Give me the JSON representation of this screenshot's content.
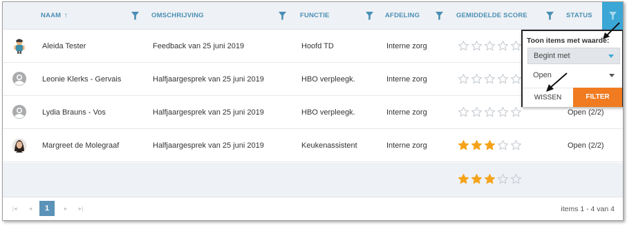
{
  "columns": {
    "naam": "Naam",
    "sort_indicator": "↑",
    "omschrijving": "Omschrijving",
    "functie": "Functie",
    "afdeling": "Afdeling",
    "gemiddelde_score": "Gemiddelde score",
    "status": "Status"
  },
  "rows": [
    {
      "naam": "Aleida Tester",
      "omschrijving": "Feedback van 25 juni 2019",
      "functie": "Hoofd TD",
      "afdeling": "Interne zorg",
      "score": 0,
      "status": "",
      "avatar": "character-avatar-icon"
    },
    {
      "naam": "Leonie Klerks - Gervais",
      "omschrijving": "Halfjaargesprek van 25 juni 2019",
      "functie": "HBO verpleegk.",
      "afdeling": "Interne zorg",
      "score": 0,
      "status": "",
      "avatar": "default-avatar-icon"
    },
    {
      "naam": "Lydia Brauns - Vos",
      "omschrijving": "Halfjaargesprek van 25 juni 2019",
      "functie": "HBO verpleegk.",
      "afdeling": "Interne zorg",
      "score": 0,
      "status": "Open (2/2)",
      "avatar": "default-avatar-icon"
    },
    {
      "naam": "Margreet de Molegraaf",
      "omschrijving": "Halfjaargesprek van 25 juni 2019",
      "functie": "Keukenassistent",
      "afdeling": "Interne zorg",
      "score": 3,
      "status": "Open (2/2)",
      "avatar": "photo-avatar-icon"
    }
  ],
  "footer": {
    "average_score": 3,
    "max_score": 5
  },
  "pager": {
    "current_page": "1",
    "info": "items 1 - 4 van 4"
  },
  "filter_popup": {
    "title": "Toon items met waarde:",
    "operator": "Begint met",
    "value": "Open",
    "clear_label": "WISSEN",
    "filter_label": "FILTER"
  },
  "colors": {
    "accent": "#3aa7d6",
    "header_text": "#4a8fb4",
    "star_filled": "#f5a31a",
    "star_empty": "#c8cdd3",
    "filter_button": "#f07b20",
    "pager_active": "#5b92b8"
  }
}
